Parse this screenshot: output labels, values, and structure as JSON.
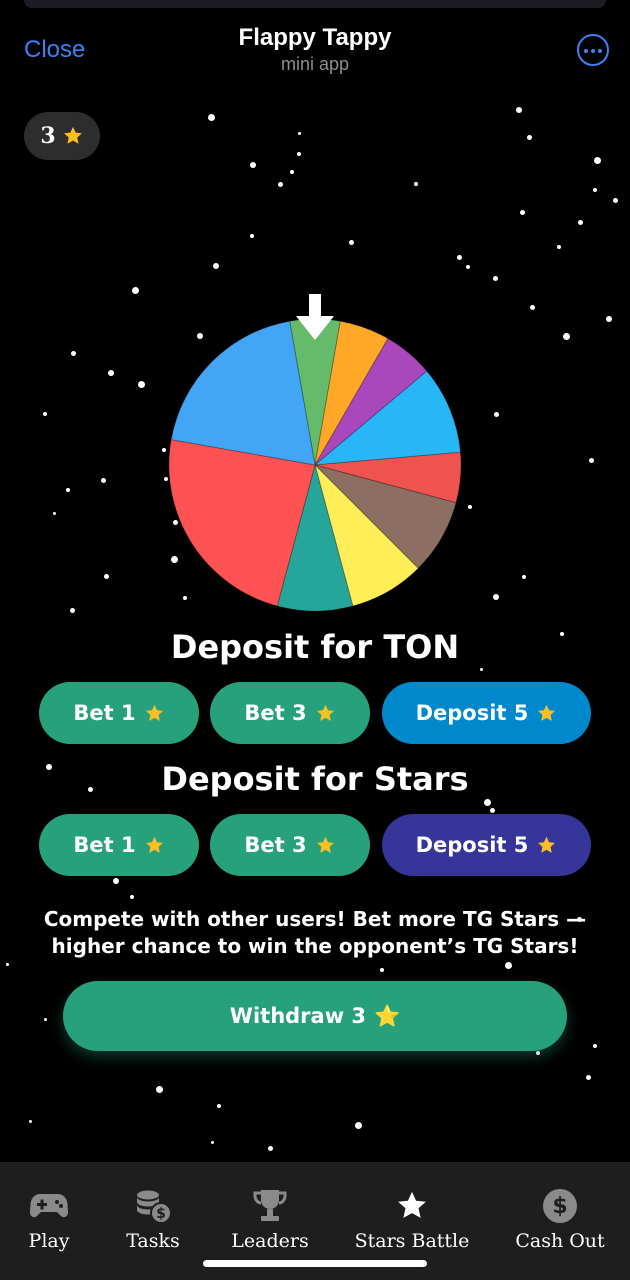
{
  "header": {
    "close_label": "Close",
    "title": "Flappy Tappy",
    "subtitle": "mini app",
    "more_icon": "ellipsis-circle-icon"
  },
  "balance": {
    "value": "3",
    "icon": "star-icon"
  },
  "wheel": {
    "segments": [
      {
        "color": "#66bb6a"
      },
      {
        "color": "#ffa726"
      },
      {
        "color": "#ab47bc"
      },
      {
        "color": "#29b6f6"
      },
      {
        "color": "#ef5350"
      },
      {
        "color": "#8d6e63"
      },
      {
        "color": "#ffee58"
      },
      {
        "color": "#26a69a"
      },
      {
        "color": "#ff5252"
      },
      {
        "color": "#42a5f5"
      }
    ],
    "pointer_icon": "arrow-down-icon"
  },
  "ton_section": {
    "title": "Deposit for TON",
    "buttons": [
      {
        "label": "Bet 1"
      },
      {
        "label": "Bet 3"
      },
      {
        "label": "Deposit 5"
      }
    ]
  },
  "stars_section": {
    "title": "Deposit for Stars",
    "buttons": [
      {
        "label": "Bet 1"
      },
      {
        "label": "Bet 3"
      },
      {
        "label": "Deposit 5"
      }
    ]
  },
  "description": "Compete with other users! Bet more TG Stars — higher chance to win the opponent’s TG Stars!",
  "withdraw": {
    "label": "Withdraw 3",
    "emoji": "⭐"
  },
  "tabs": [
    {
      "label": "Play",
      "icon": "gamepad-icon"
    },
    {
      "label": "Tasks",
      "icon": "coins-icon"
    },
    {
      "label": "Leaders",
      "icon": "trophy-icon"
    },
    {
      "label": "Stars Battle",
      "icon": "star-icon"
    },
    {
      "label": "Cash Out",
      "icon": "dollar-coin-icon"
    }
  ],
  "colors": {
    "accent_blue": "#3a82f7",
    "green": "#26a17b",
    "ton_blue": "#0088cc",
    "stars_indigo": "#36359a",
    "star_gold": "#fbbf24"
  }
}
